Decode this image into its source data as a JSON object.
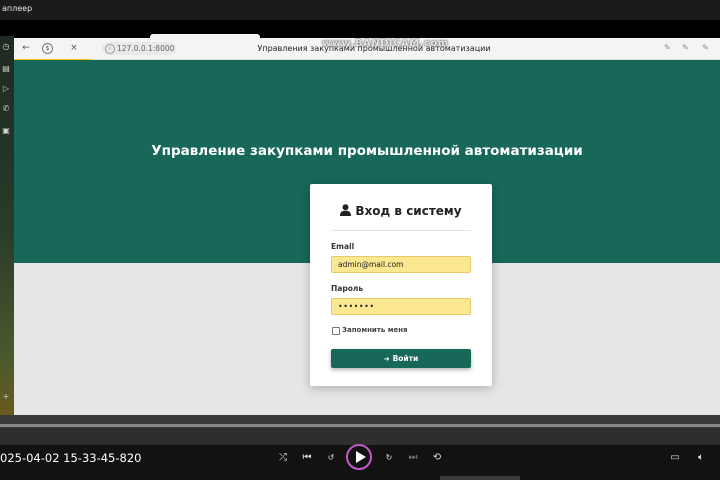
{
  "player": {
    "window_title": "аплеер",
    "timestamp": "025-04-02 15-33-45-820",
    "controls": [
      "shuffle-icon",
      "previous-icon",
      "rewind-10-icon",
      "play-icon",
      "forward-30-icon",
      "next-icon",
      "repeat-off-icon"
    ],
    "right_controls": [
      "miniplayer-icon",
      "volume-icon"
    ]
  },
  "browser": {
    "url": "127.0.0.1:8000",
    "tab_title": "Управления закупками промышленной автоматизации",
    "watermark": "www.BANDICAM.com"
  },
  "page": {
    "hero_title": "Управление закупками промышленной автоматизации",
    "login": {
      "heading": "Вход в систему",
      "email_label": "Email",
      "email_value": "admin@mail.com",
      "password_label": "Пароль",
      "password_value": "•••••••",
      "remember_label": "Запомнить меня",
      "submit_label": "Войти"
    }
  },
  "colors": {
    "primary": "#176859",
    "autofill": "#fde892",
    "accent_play": "#c25bc9"
  }
}
